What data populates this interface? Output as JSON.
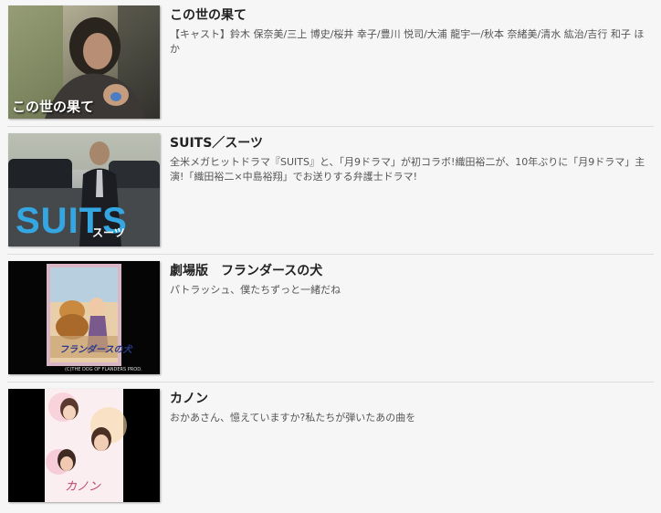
{
  "items": [
    {
      "title": "この世の果て",
      "description": "【キャスト】鈴木 保奈美/三上 博史/桜井 幸子/豊川 悦司/大浦 龍宇一/秋本 奈緒美/清水 紘治/吉行 和子 ほか",
      "thumb_caption": "この世の果て"
    },
    {
      "title": "SUITS／スーツ",
      "description": "全米メガヒットドラマ『SUITS』と、「月9ドラマ」が初コラボ!織田裕二が、10年ぶりに「月9ドラマ」主演!「織田裕二×中島裕翔」でお送りする弁護士ドラマ!",
      "thumb_logo": "SUITS",
      "thumb_logo_sub": "スーツ"
    },
    {
      "title": "劇場版　フランダースの犬",
      "description": "パトラッシュ、僕たちずっと一緒だね",
      "thumb_caption": "フランダースの犬",
      "thumb_credit": "(C)THE DOG OF FLANDERS PROD."
    },
    {
      "title": "カノン",
      "description": "おかあさん、憶えていますか?私たちが弾いたあの曲を",
      "thumb_caption": "カノン"
    }
  ]
}
